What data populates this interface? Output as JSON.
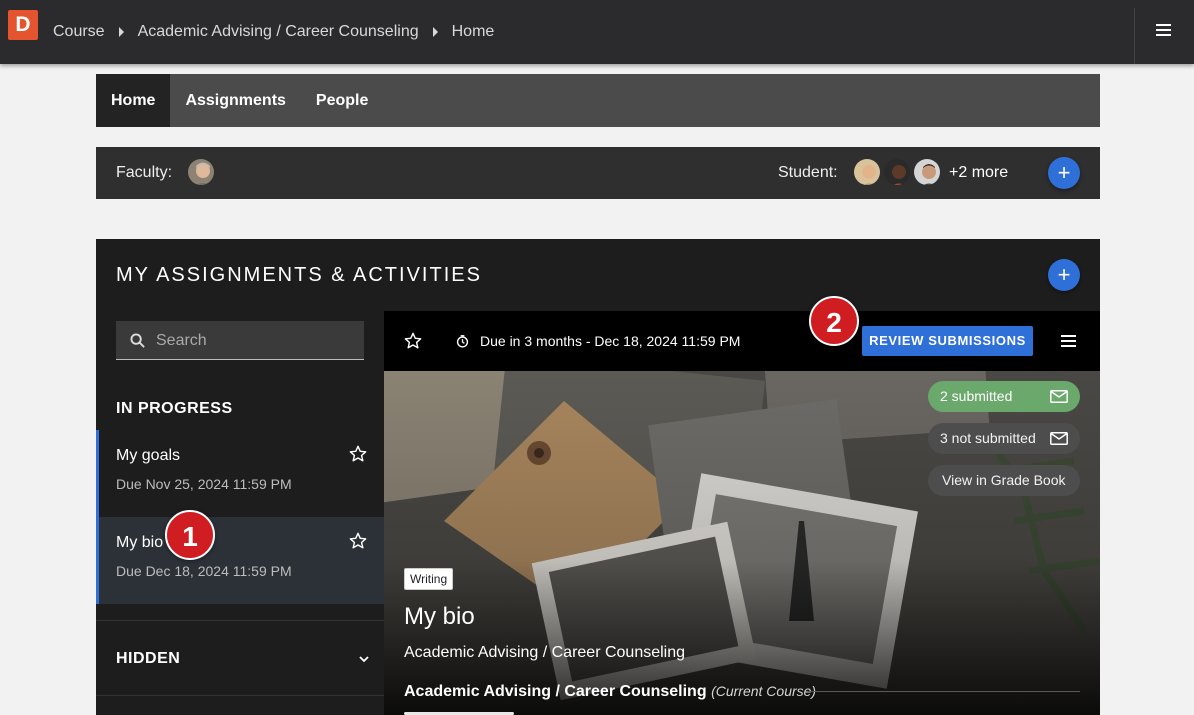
{
  "app": {
    "logo_letter": "D"
  },
  "breadcrumb": [
    "Course",
    "Academic Advising / Career Counseling",
    "Home"
  ],
  "tabs": [
    {
      "label": "Home",
      "active": true
    },
    {
      "label": "Assignments",
      "active": false
    },
    {
      "label": "People",
      "active": false
    }
  ],
  "people_bar": {
    "faculty_label": "Faculty:",
    "student_label": "Student:",
    "more_text": "+2 more"
  },
  "panel": {
    "title": "MY ASSIGNMENTS & ACTIVITIES"
  },
  "sidebar": {
    "search_placeholder": "Search",
    "in_progress_label": "IN PROGRESS",
    "items": [
      {
        "title": "My goals",
        "due": "Due Nov 25, 2024 11:59 PM",
        "selected": false
      },
      {
        "title": "My bio",
        "due": "Due Dec 18, 2024 11:59 PM",
        "selected": true
      }
    ],
    "hidden_label": "HIDDEN"
  },
  "detail": {
    "due_text": "Due in 3 months - Dec 18, 2024 11:59 PM",
    "review_button": "REVIEW SUBMISSIONS",
    "submitted_pill": "2 submitted",
    "not_submitted_pill": "3 not submitted",
    "gradebook_pill": "View in Grade Book",
    "tag": "Writing",
    "title": "My bio",
    "subtitle": "Academic Advising / Career Counseling",
    "course_name": "Academic Advising / Career Counseling",
    "course_note": "(Current Course)"
  },
  "callouts": [
    "1",
    "2"
  ],
  "colors": {
    "accent": "#2f6fd8",
    "callout": "#cf1d22",
    "submitted": "#6aa86b",
    "logo": "#e4542f"
  }
}
